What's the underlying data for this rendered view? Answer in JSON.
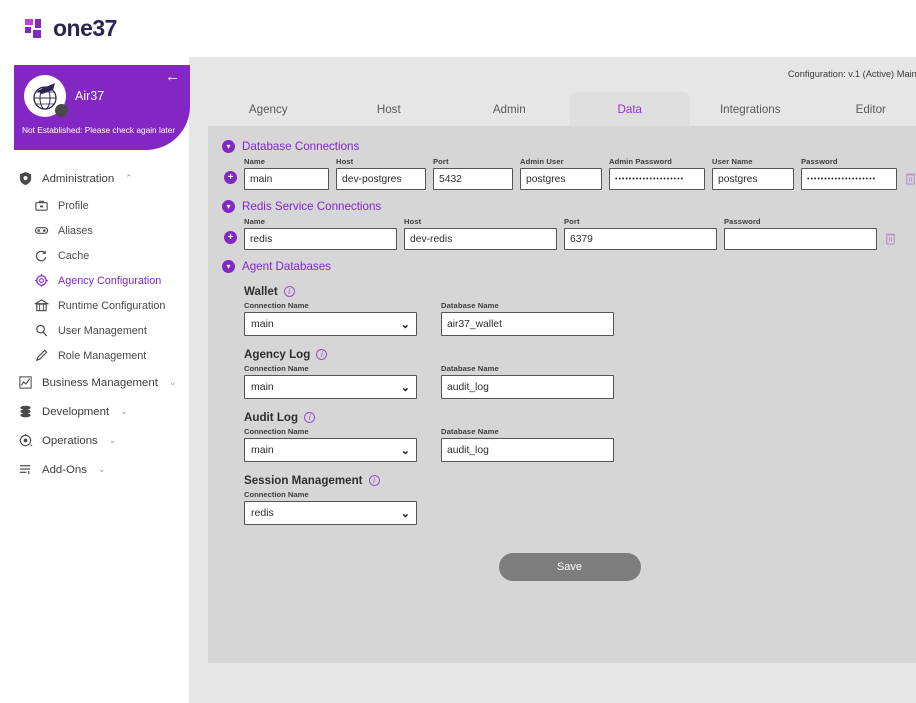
{
  "brand": {
    "name": "one37"
  },
  "profile": {
    "name": "Air37",
    "status": "Not Established: Please check again later",
    "back_icon": "back-arrow-icon"
  },
  "sidebar": {
    "groups": [
      {
        "label": "Administration",
        "icon": "shield-icon",
        "expanded": true,
        "caret": "⌃",
        "items": [
          {
            "label": "Profile",
            "icon": "briefcase-icon",
            "active": false
          },
          {
            "label": "Aliases",
            "icon": "mask-icon",
            "active": false
          },
          {
            "label": "Cache",
            "icon": "refresh-icon",
            "active": false
          },
          {
            "label": "Agency Configuration",
            "icon": "gear-icon",
            "active": true
          },
          {
            "label": "Runtime Configuration",
            "icon": "bank-icon",
            "active": false
          },
          {
            "label": "User Management",
            "icon": "magnifier-icon",
            "active": false
          },
          {
            "label": "Role Management",
            "icon": "pencil-icon",
            "active": false
          }
        ]
      },
      {
        "label": "Business Management",
        "icon": "chart-icon",
        "expanded": false,
        "caret": "⌄",
        "items": []
      },
      {
        "label": "Development",
        "icon": "database-icon",
        "expanded": false,
        "caret": "⌄",
        "items": []
      },
      {
        "label": "Operations",
        "icon": "settings-icon",
        "expanded": false,
        "caret": "⌄",
        "items": []
      },
      {
        "label": "Add-Ons",
        "icon": "list-icon",
        "expanded": false,
        "caret": "⌄",
        "items": []
      }
    ]
  },
  "header": {
    "configuration_label": "Configuration: v.1 (Active) Main",
    "configuration_caret": "⌄"
  },
  "tabs": [
    {
      "label": "Agency",
      "active": false
    },
    {
      "label": "Host",
      "active": false
    },
    {
      "label": "Admin",
      "active": false
    },
    {
      "label": "Data",
      "active": true
    },
    {
      "label": "Integrations",
      "active": false
    },
    {
      "label": "Editor",
      "active": false
    }
  ],
  "database_connections": {
    "title": "Database Connections",
    "collapse_icon": "chevron-circle-icon",
    "add_icon": "add-circle-icon",
    "delete_icon": "trash-icon",
    "columns": [
      {
        "label": "Name",
        "width": 85
      },
      {
        "label": "Host",
        "width": 90
      },
      {
        "label": "Port",
        "width": 80
      },
      {
        "label": "Admin User",
        "width": 82
      },
      {
        "label": "Admin Password",
        "width": 96
      },
      {
        "label": "User Name",
        "width": 82
      },
      {
        "label": "Password",
        "width": 96
      }
    ],
    "row": {
      "name": "main",
      "host": "dev-postgres",
      "port": "5432",
      "admin_user": "postgres",
      "admin_password": "••••••••••••••••••••",
      "user_name": "postgres",
      "password": "••••••••••••••••••••"
    }
  },
  "redis_connections": {
    "title": "Redis Service Connections",
    "collapse_icon": "chevron-circle-icon",
    "add_icon": "add-circle-icon",
    "delete_icon": "trash-icon",
    "columns": [
      {
        "label": "Name",
        "width": 153
      },
      {
        "label": "Host",
        "width": 153
      },
      {
        "label": "Port",
        "width": 153
      },
      {
        "label": "Password",
        "width": 153
      }
    ],
    "row": {
      "name": "redis",
      "host": "dev-redis",
      "port": "6379",
      "password": ""
    }
  },
  "agent_databases": {
    "title": "Agent Databases",
    "collapse_icon": "chevron-circle-icon",
    "info_icon": "info-icon",
    "chevron_icon": "chevron-down-icon",
    "connection_label": "Connection Name",
    "database_label": "Database Name",
    "entries": [
      {
        "title": "Wallet",
        "connection": "main",
        "database": "air37_wallet",
        "has_database": true
      },
      {
        "title": "Agency Log",
        "connection": "main",
        "database": "audit_log",
        "has_database": true
      },
      {
        "title": "Audit Log",
        "connection": "main",
        "database": "audit_log",
        "has_database": true
      },
      {
        "title": "Session Management",
        "connection": "redis",
        "database": "",
        "has_database": false
      }
    ]
  },
  "actions": {
    "save_label": "Save"
  },
  "colors": {
    "brand_purple": "#8227c4",
    "accent_purple": "#9b2fd0",
    "panel_gray": "#d6d6d6",
    "content_gray": "#e6e6e6",
    "save_gray": "#7d7d7d"
  }
}
